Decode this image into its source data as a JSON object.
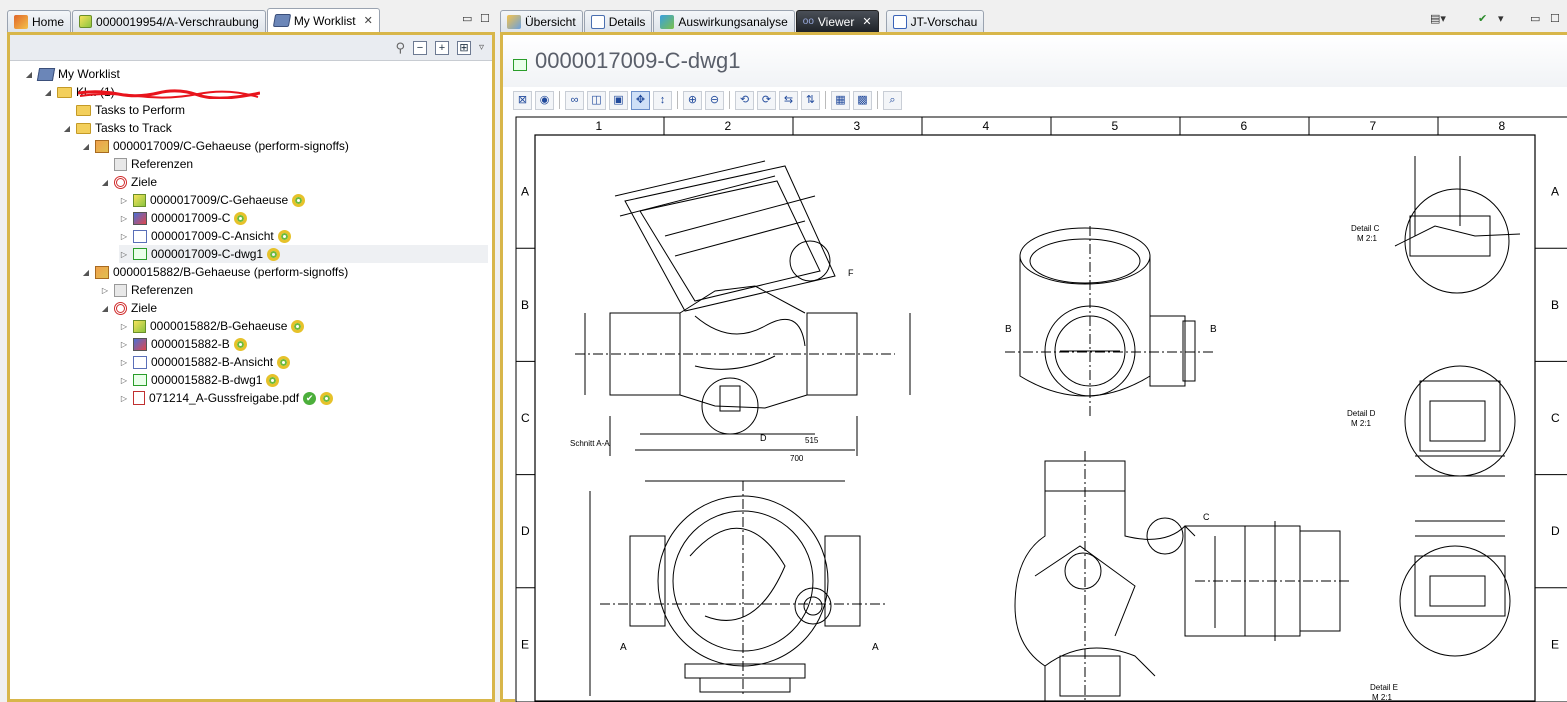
{
  "left_tabs": [
    {
      "label": "Home",
      "icon": "home-icon"
    },
    {
      "label": "0000019954/A-Verschraubung",
      "icon": "cube-icon"
    },
    {
      "label": "My Worklist",
      "icon": "worklist-icon",
      "active": true
    }
  ],
  "right_tabs": [
    {
      "label": "Übersicht",
      "icon": "overview-icon"
    },
    {
      "label": "Details",
      "icon": "details-icon"
    },
    {
      "label": "Auswirkungsanalyse",
      "icon": "impact-icon"
    },
    {
      "label": "Viewer",
      "icon": "viewer-icon",
      "active": true
    },
    {
      "label": "JT-Vorschau",
      "icon": "jt-preview-icon"
    }
  ],
  "tree": [
    {
      "label": "My Worklist",
      "level": 0,
      "twist": "expanded",
      "icon": "worklist-icon"
    },
    {
      "label": "Kl... (1)",
      "level": 1,
      "twist": "expanded",
      "icon": "folder-icon",
      "redacted": true
    },
    {
      "label": "Tasks to Perform",
      "level": 2,
      "twist": "none",
      "icon": "folder-icon"
    },
    {
      "label": "Tasks to Track",
      "level": 2,
      "twist": "expanded",
      "icon": "folder-icon"
    },
    {
      "label": "0000017009/C-Gehaeuse (perform-signoffs)",
      "level": 3,
      "twist": "expanded",
      "icon": "task-icon"
    },
    {
      "label": "Referenzen",
      "level": 4,
      "twist": "none",
      "icon": "reference-icon"
    },
    {
      "label": "Ziele",
      "level": 4,
      "twist": "expanded",
      "icon": "target-icon"
    },
    {
      "label": "0000017009/C-Gehaeuse",
      "level": 5,
      "twist": "collapsed",
      "icon": "cube-icon",
      "status": "ring"
    },
    {
      "label": "0000017009-C",
      "level": 5,
      "twist": "collapsed",
      "icon": "revision-icon",
      "status": "ring"
    },
    {
      "label": "0000017009-C-Ansicht",
      "level": 5,
      "twist": "collapsed",
      "icon": "view-icon",
      "status": "ring"
    },
    {
      "label": "0000017009-C-dwg1",
      "level": 5,
      "twist": "collapsed",
      "icon": "drawing-icon",
      "status": "ring",
      "selected": true
    },
    {
      "label": "0000015882/B-Gehaeuse (perform-signoffs)",
      "level": 3,
      "twist": "expanded",
      "icon": "task-icon"
    },
    {
      "label": "Referenzen",
      "level": 4,
      "twist": "collapsed",
      "icon": "reference-icon"
    },
    {
      "label": "Ziele",
      "level": 4,
      "twist": "expanded",
      "icon": "target-icon"
    },
    {
      "label": "0000015882/B-Gehaeuse",
      "level": 5,
      "twist": "collapsed",
      "icon": "cube-icon",
      "status": "ring"
    },
    {
      "label": "0000015882-B",
      "level": 5,
      "twist": "collapsed",
      "icon": "revision-icon",
      "status": "ring"
    },
    {
      "label": "0000015882-B-Ansicht",
      "level": 5,
      "twist": "collapsed",
      "icon": "view-icon",
      "status": "ring"
    },
    {
      "label": "0000015882-B-dwg1",
      "level": 5,
      "twist": "collapsed",
      "icon": "drawing-icon",
      "status": "ring"
    },
    {
      "label": "071214_A-Gussfreigabe.pdf",
      "level": 5,
      "twist": "collapsed",
      "icon": "pdf-icon",
      "status": "check-ring"
    }
  ],
  "viewer": {
    "title": "0000017009-C-dwg1",
    "columns": [
      "1",
      "2",
      "3",
      "4",
      "5",
      "6",
      "7",
      "8"
    ],
    "rows": [
      "A",
      "B",
      "C",
      "D",
      "E"
    ],
    "annotations": {
      "section_label": "Schnitt A-A",
      "detail_c": "Detail C",
      "detail_c_scale": "M 2:1",
      "detail_d": "Detail D",
      "detail_d_scale": "M 2:1",
      "detail_e": "Detail E",
      "detail_e_scale": "M 2:1",
      "dim_515": "515",
      "dim_700": "700",
      "cut_a": "A",
      "cut_b": "B",
      "cut_c": "C",
      "cut_d": "D",
      "cut_f": "F"
    }
  }
}
